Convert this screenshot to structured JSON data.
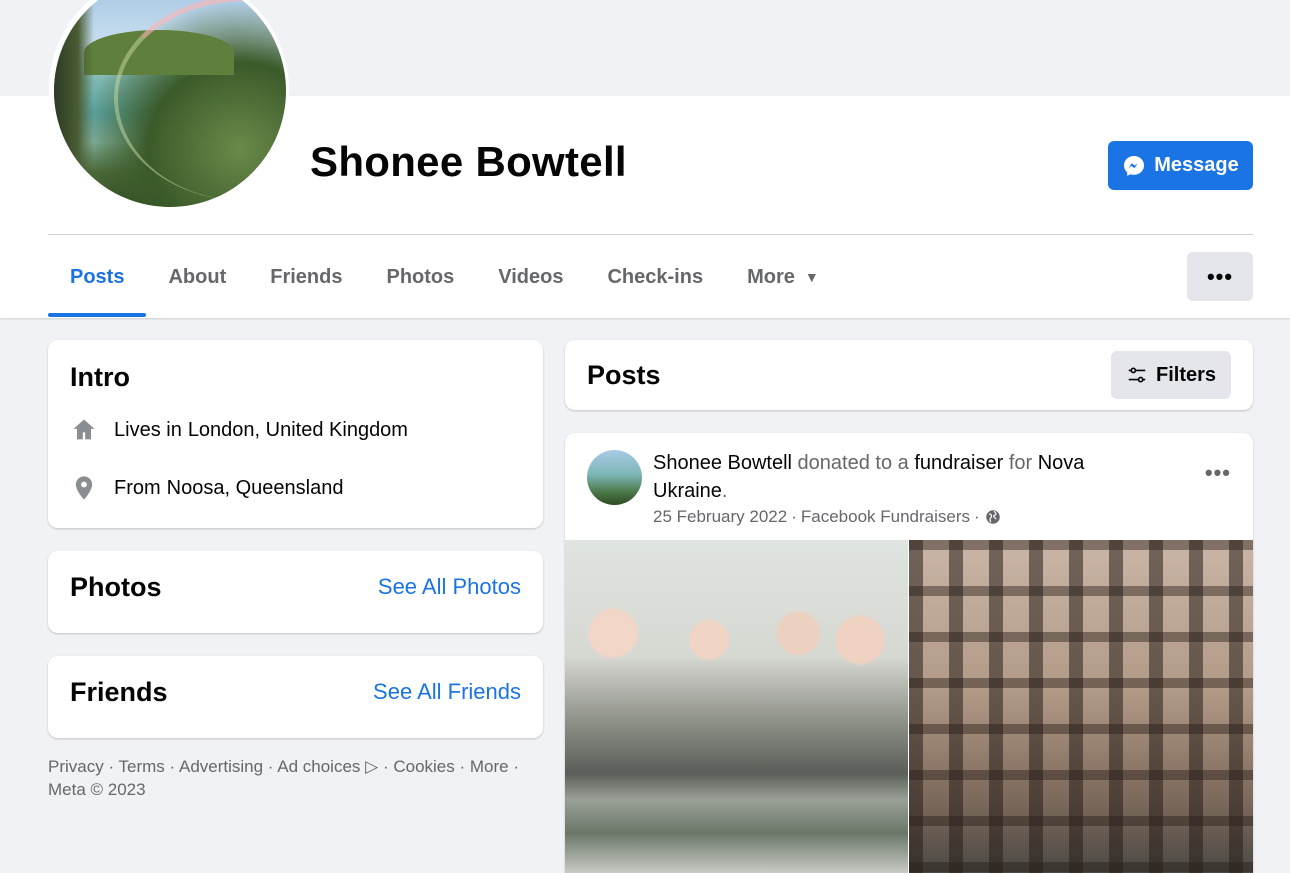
{
  "profile": {
    "name": "Shonee Bowtell",
    "message_label": "Message"
  },
  "tabs": [
    {
      "label": "Posts"
    },
    {
      "label": "About"
    },
    {
      "label": "Friends"
    },
    {
      "label": "Photos"
    },
    {
      "label": "Videos"
    },
    {
      "label": "Check-ins"
    },
    {
      "label": "More"
    }
  ],
  "intro": {
    "title": "Intro",
    "lives_prefix": "Lives in",
    "lives_value": "London, United Kingdom",
    "from_prefix": "From",
    "from_value": "Noosa, Queensland"
  },
  "photos_card": {
    "title": "Photos",
    "link": "See All Photos"
  },
  "friends_card": {
    "title": "Friends",
    "link": "See All Friends"
  },
  "footer": {
    "links": "Privacy · Terms · Advertising · Ad choices",
    "links2": "· Cookies · More ·",
    "copyright": "Meta © 2023"
  },
  "posts": {
    "title": "Posts",
    "filters_label": "Filters"
  },
  "post": {
    "author": "Shonee Bowtell",
    "action1": "donated to a",
    "link1": "fundraiser",
    "action2": "for",
    "link2": "Nova Ukraine",
    "end": ".",
    "date": "25 February 2022",
    "source": "Facebook Fundraisers",
    "sep": "·"
  },
  "colors": {
    "accent": "#1b74e4",
    "page_bg": "#f0f2f5",
    "muted_text": "#65676b"
  },
  "icons": [
    "messenger-icon",
    "more-dots-icon",
    "caret-down-icon",
    "home-icon",
    "location-pin-icon",
    "filters-icon",
    "globe-icon",
    "ad-choices-icon"
  ]
}
